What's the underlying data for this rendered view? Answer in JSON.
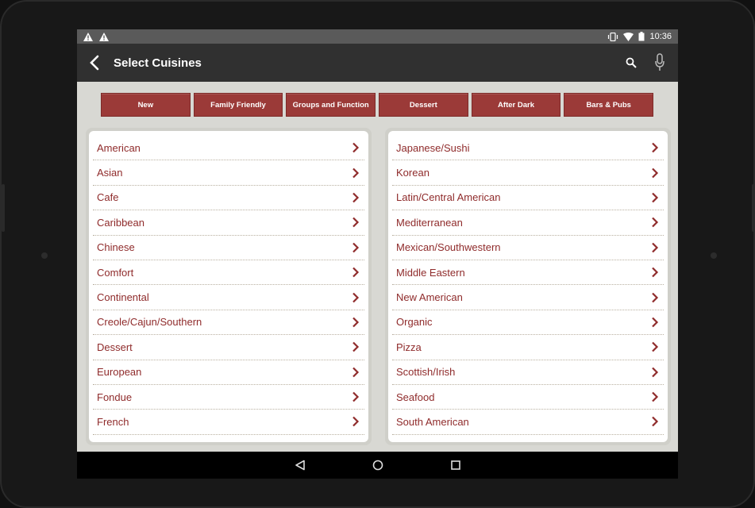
{
  "status_bar": {
    "time": "10:36",
    "icons": [
      "warning-icon",
      "warning-icon",
      "vibrate-icon",
      "wifi-icon",
      "battery-icon"
    ]
  },
  "app_bar": {
    "title": "Select Cuisines",
    "actions": [
      "search-icon",
      "microphone-icon"
    ]
  },
  "tabs": [
    {
      "label": "New"
    },
    {
      "label": "Family Friendly"
    },
    {
      "label": "Groups and Function"
    },
    {
      "label": "Dessert"
    },
    {
      "label": "After Dark"
    },
    {
      "label": "Bars & Pubs"
    }
  ],
  "left_list": [
    {
      "label": "American"
    },
    {
      "label": "Asian"
    },
    {
      "label": "Cafe"
    },
    {
      "label": "Caribbean"
    },
    {
      "label": "Chinese"
    },
    {
      "label": "Comfort"
    },
    {
      "label": "Continental"
    },
    {
      "label": "Creole/Cajun/Southern"
    },
    {
      "label": "Dessert"
    },
    {
      "label": "European"
    },
    {
      "label": "Fondue"
    },
    {
      "label": "French"
    }
  ],
  "right_list": [
    {
      "label": "Japanese/Sushi"
    },
    {
      "label": "Korean"
    },
    {
      "label": "Latin/Central American"
    },
    {
      "label": "Mediterranean"
    },
    {
      "label": "Mexican/Southwestern"
    },
    {
      "label": "Middle Eastern"
    },
    {
      "label": "New American"
    },
    {
      "label": "Organic"
    },
    {
      "label": "Pizza"
    },
    {
      "label": "Scottish/Irish"
    },
    {
      "label": "Seafood"
    },
    {
      "label": "South American"
    }
  ],
  "colors": {
    "accent": "#9b3a38",
    "item_text": "#8f2b2b",
    "app_bar": "#303030",
    "status_bar": "#5a5a5a"
  },
  "nav_bar": [
    "back-triangle-icon",
    "home-circle-icon",
    "recents-square-icon"
  ]
}
